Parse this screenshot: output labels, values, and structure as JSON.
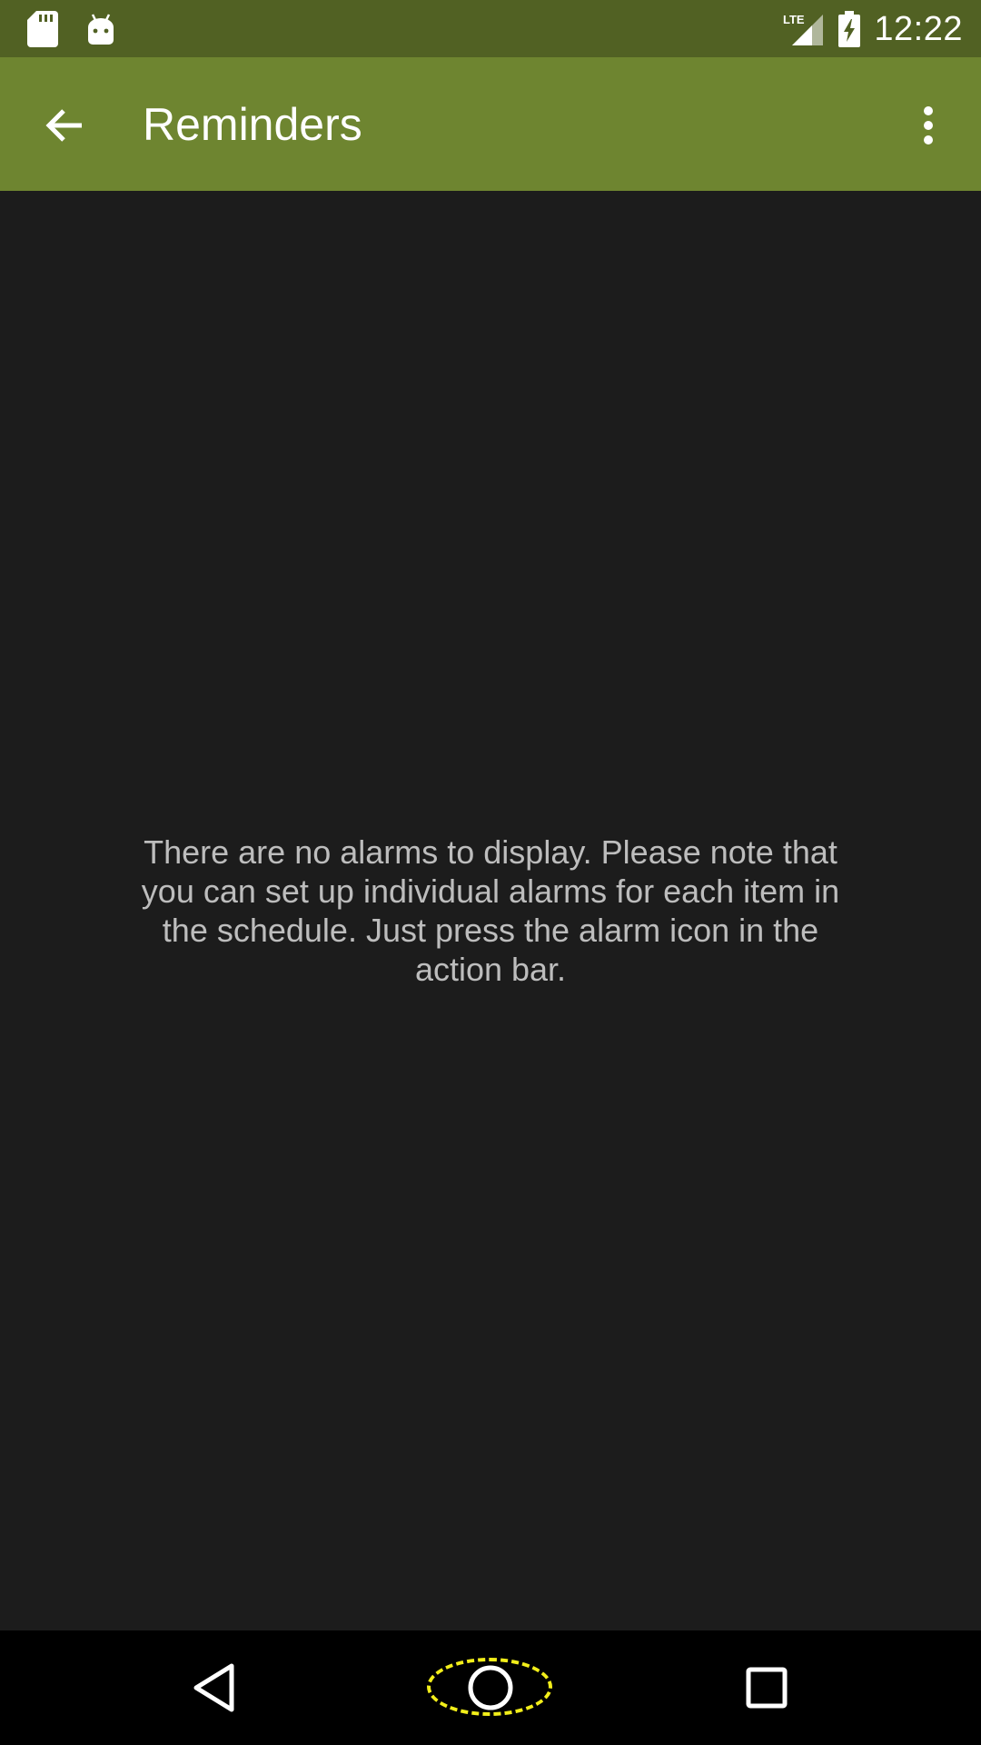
{
  "status_bar": {
    "time": "12:22",
    "network_label": "LTE",
    "icons": [
      "sd-card-icon",
      "android-icon",
      "lte-signal-icon",
      "battery-charging-icon"
    ]
  },
  "toolbar": {
    "title": "Reminders",
    "back_icon": "arrow-back-icon",
    "overflow_icon": "more-vert-icon",
    "background_color": "#6e8530"
  },
  "content": {
    "empty_message": "There are no alarms to display. Please note that you can set up individual alarms for each item in the schedule. Just press the alarm icon in the action bar."
  },
  "nav_bar": {
    "buttons": [
      "nav-back-icon",
      "nav-home-icon",
      "nav-recents-icon"
    ]
  },
  "colors": {
    "status_bar": "#516123",
    "toolbar": "#6e8530",
    "background": "#1c1c1c",
    "message_text": "#bdbdbd",
    "highlight": "#f2ee1a"
  }
}
